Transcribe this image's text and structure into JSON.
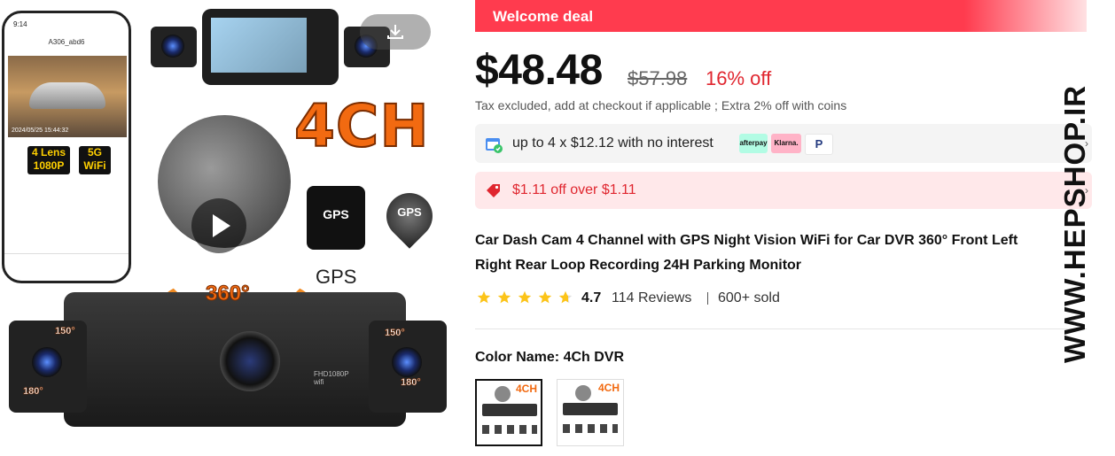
{
  "gallery": {
    "phone": {
      "status_time": "9:14",
      "device_name": "A306_abd6",
      "timestamp": "2024/05/25 15:44:32",
      "badge_lens": "4 Lens",
      "badge_res": "1080P",
      "badge_5g": "5G",
      "badge_wifi": "WiFi"
    },
    "headline": "4CH",
    "gps_box_label": "GPS",
    "gps_pin_label": "GPS",
    "gps_text": "GPS",
    "rotation": "360°",
    "main_cam_text": "FHD1080P",
    "main_cam_wifi": "wifi",
    "deg_150_left": "150°",
    "deg_180_left": "180°",
    "deg_150_right": "150°",
    "deg_180_right": "180°",
    "icons": {
      "play": "play-icon",
      "download": "download-icon"
    }
  },
  "deal": {
    "label": "Welcome deal"
  },
  "pricing": {
    "price": "$48.48",
    "original": "$57.98",
    "discount": "16% off",
    "tax_note": "Tax excluded, add at checkout if applicable ; Extra 2% off with coins"
  },
  "installments": {
    "text": "up to 4 x $12.12 with no interest",
    "providers": [
      "afterpay",
      "Klarna.",
      "P"
    ]
  },
  "coupon": {
    "text": "$1.11 off over $1.11"
  },
  "product": {
    "title_line1": "Car Dash Cam 4 Channel with GPS Night Vision WiFi for Car DVR 360° Front Left",
    "title_line2": "Right Rear Loop Recording 24H Parking Monitor"
  },
  "rating": {
    "value": "4.7",
    "stars": 4.7,
    "reviews": "114 Reviews",
    "sold": "600+ sold"
  },
  "variants": {
    "label": "Color Name: 4Ch DVR",
    "options": [
      {
        "mini_label": "4CH",
        "selected": true
      },
      {
        "mini_label": "4CH",
        "selected": false
      }
    ]
  },
  "watermark": "WWW.HEPSHOP.IR",
  "colors": {
    "accent": "#ff3b4e",
    "discount": "#e0262f",
    "star": "#fcc419",
    "brand_orange": "#f26a11"
  }
}
